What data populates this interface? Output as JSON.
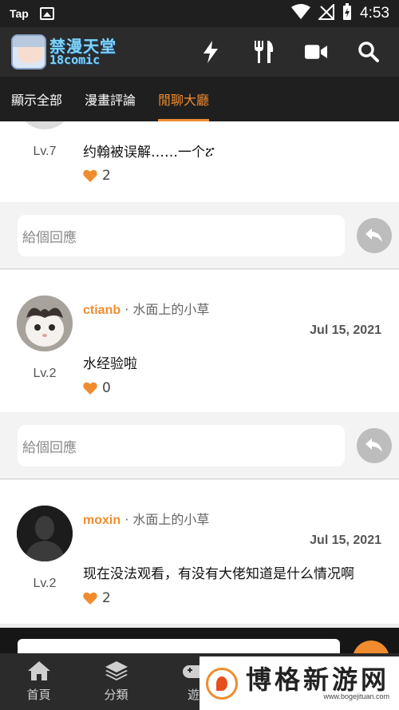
{
  "status_bar": {
    "app_name": "Tap",
    "time": "4:53"
  },
  "app": {
    "logo_line1": "禁漫天堂",
    "logo_line2": "18comic",
    "header_icons": [
      "flash-icon",
      "fork-knife-icon",
      "video-camera-icon",
      "search-icon"
    ]
  },
  "tabs": [
    {
      "label": "顯示全部",
      "active": false
    },
    {
      "label": "漫畫評論",
      "active": false
    },
    {
      "label": "閒聊大廳",
      "active": true
    }
  ],
  "posts": [
    {
      "level": "Lv.7",
      "content": "约翰被误解……一个ፘ",
      "likes": "2"
    },
    {
      "username": "ctianb",
      "separator": "·",
      "topic": "水面上的小草",
      "date": "Jul 15, 2021",
      "level": "Lv.2",
      "content": "水经验啦",
      "likes": "0"
    },
    {
      "username": "moxin",
      "separator": "·",
      "topic": "水面上的小草",
      "date": "Jul 15, 2021",
      "level": "Lv.2",
      "content": "现在没法观看，有没有大佬知道是什么情况啊",
      "likes": "2"
    }
  ],
  "reply": {
    "placeholder": "給個回應"
  },
  "bottom_nav": [
    {
      "label": "首頁",
      "icon": "home-icon"
    },
    {
      "label": "分類",
      "icon": "layers-icon"
    },
    {
      "label": "遊",
      "icon": "gamepad-icon"
    }
  ],
  "watermark": {
    "title": "博格新游网",
    "url": "www.bogejituan.com"
  },
  "colors": {
    "accent": "#f08c2e",
    "dark_bar": "#2b2b2b",
    "status_bar": "#1f1f1f"
  }
}
